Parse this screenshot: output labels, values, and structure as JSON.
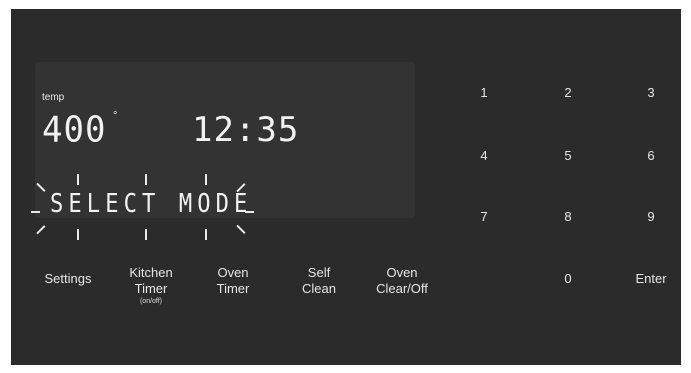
{
  "display": {
    "temp_label": "temp",
    "temperature": "400",
    "degree_symbol": "°",
    "clock": "12:35",
    "mode_message": "SELECT MODE"
  },
  "function_buttons": {
    "settings": "Settings",
    "kitchen_timer_line1": "Kitchen",
    "kitchen_timer_line2": "Timer",
    "kitchen_timer_sub": "(on/off)",
    "oven_timer_line1": "Oven",
    "oven_timer_line2": "Timer",
    "self_clean_line1": "Self",
    "self_clean_line2": "Clean",
    "oven_clear_line1": "Oven",
    "oven_clear_line2": "Clear/Off"
  },
  "keypad": {
    "k1": "1",
    "k2": "2",
    "k3": "3",
    "k4": "4",
    "k5": "5",
    "k6": "6",
    "k7": "7",
    "k8": "8",
    "k9": "9",
    "k0": "0",
    "enter": "Enter"
  }
}
